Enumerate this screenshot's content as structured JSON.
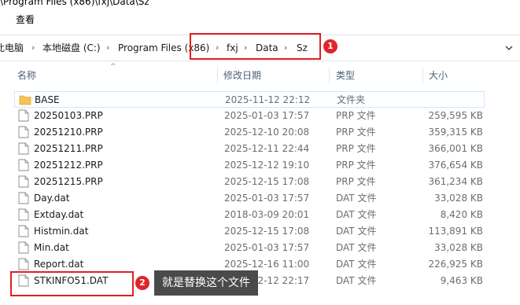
{
  "window": {
    "path_title": "\\Program Files (x86)\\fxj\\Data\\Sz"
  },
  "ribbon": {
    "view_tab": "查看"
  },
  "breadcrumb": {
    "items": [
      "此电脑",
      "本地磁盘 (C:)",
      "Program Files (x86)",
      "fxj",
      "Data",
      "Sz"
    ],
    "separator": "›"
  },
  "columns": {
    "name": "名称",
    "date": "修改日期",
    "type": "类型",
    "size": "大小"
  },
  "files": [
    {
      "name": "BASE",
      "date": "2025-11-12 22:12",
      "type": "文件夹",
      "size": "",
      "kind": "folder"
    },
    {
      "name": "20250103.PRP",
      "date": "2025-01-03 17:57",
      "type": "PRP 文件",
      "size": "259,595 KB",
      "kind": "file"
    },
    {
      "name": "20251210.PRP",
      "date": "2025-12-10 20:08",
      "type": "PRP 文件",
      "size": "359,315 KB",
      "kind": "file"
    },
    {
      "name": "20251211.PRP",
      "date": "2025-12-11 22:44",
      "type": "PRP 文件",
      "size": "366,001 KB",
      "kind": "file"
    },
    {
      "name": "20251212.PRP",
      "date": "2025-12-12 19:10",
      "type": "PRP 文件",
      "size": "376,654 KB",
      "kind": "file"
    },
    {
      "name": "20251215.PRP",
      "date": "2025-12-15 17:08",
      "type": "PRP 文件",
      "size": "361,234 KB",
      "kind": "file"
    },
    {
      "name": "Day.dat",
      "date": "2025-01-03 17:57",
      "type": "DAT 文件",
      "size": "33,028 KB",
      "kind": "file"
    },
    {
      "name": "Extday.dat",
      "date": "2018-03-09 20:01",
      "type": "DAT 文件",
      "size": "8,420 KB",
      "kind": "file"
    },
    {
      "name": "Histmin.dat",
      "date": "2025-12-15 17:08",
      "type": "DAT 文件",
      "size": "113,891 KB",
      "kind": "file"
    },
    {
      "name": "Min.dat",
      "date": "2025-01-03 17:57",
      "type": "DAT 文件",
      "size": "33,028 KB",
      "kind": "file"
    },
    {
      "name": "Report.dat",
      "date": "2025-12-16 11:00",
      "type": "DAT 文件",
      "size": "226,925 KB",
      "kind": "file"
    },
    {
      "name": "STKINFO51.DAT",
      "date": "2025-12-12 22:17",
      "type": "DAT 文件",
      "size": "9,463 KB",
      "kind": "file"
    }
  ],
  "annotations": {
    "marker1": "1",
    "marker2": "2",
    "tooltip": "就是替换这个文件",
    "color": "#e0242b"
  }
}
